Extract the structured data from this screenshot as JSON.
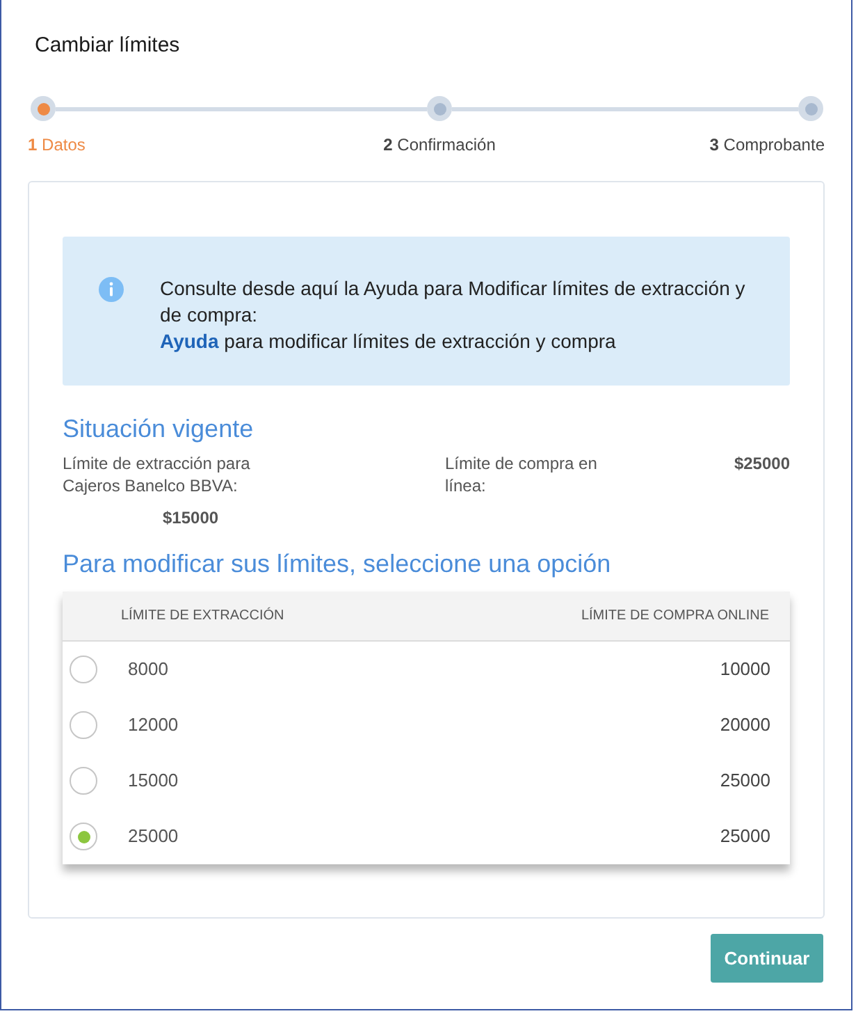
{
  "title": "Cambiar límites",
  "steps": [
    {
      "number": "1",
      "label": "Datos",
      "selected": true
    },
    {
      "number": "2",
      "label": "Confirmación",
      "selected": false
    },
    {
      "number": "3",
      "label": "Comprobante",
      "selected": false
    }
  ],
  "info": {
    "text": "Consulte desde aquí la Ayuda para Modificar límites de extracción y de compra:",
    "link": "Ayuda",
    "link_text": "para modificar límites de extracción y compra"
  },
  "current": {
    "title": "Situación vigente",
    "items": [
      {
        "label": "Límite de extracción para Cajeros Banelco BBVA:",
        "value": "$15000"
      },
      {
        "label": "Límite de compra en línea:",
        "value": "$25000"
      }
    ]
  },
  "options": {
    "title": "Para modificar sus límites, seleccione una opción",
    "columns": [
      "LÍMITE DE EXTRACCIÓN",
      "LÍMITE DE COMPRA ONLINE"
    ],
    "rows": [
      {
        "extraction": "8000",
        "purchase": "10000",
        "selected": false
      },
      {
        "extraction": "12000",
        "purchase": "20000",
        "selected": false
      },
      {
        "extraction": "15000",
        "purchase": "25000",
        "selected": false
      },
      {
        "extraction": "25000",
        "purchase": "25000",
        "selected": true
      }
    ]
  },
  "button": "Continuar"
}
